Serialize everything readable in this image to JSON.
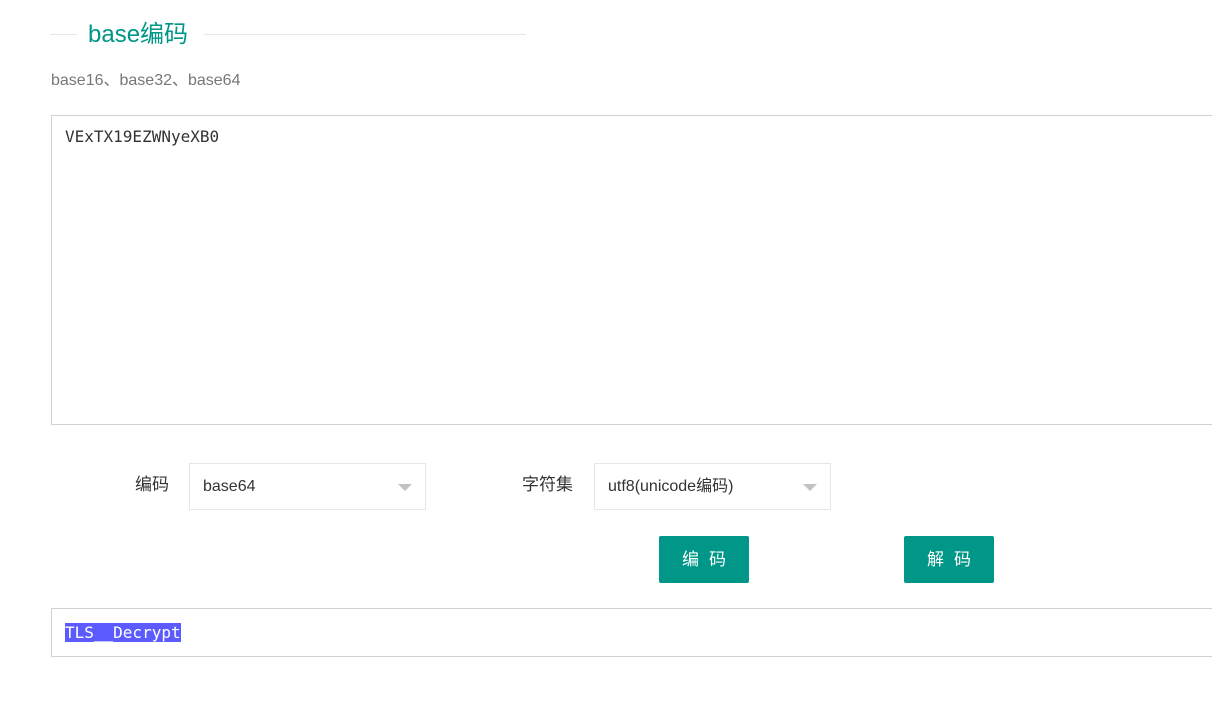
{
  "header": {
    "title": "base编码",
    "subtitle": "base16、base32、base64"
  },
  "input": {
    "value": "VExTX19EZWNyeXB0"
  },
  "controls": {
    "encoding_label": "编码",
    "encoding_value": "base64",
    "charset_label": "字符集",
    "charset_value": "utf8(unicode编码)"
  },
  "buttons": {
    "encode": "编码",
    "decode": "解码"
  },
  "output": {
    "value": "TLS__Decrypt"
  },
  "colors": {
    "accent": "#009688",
    "selection": "#5b5bff"
  }
}
